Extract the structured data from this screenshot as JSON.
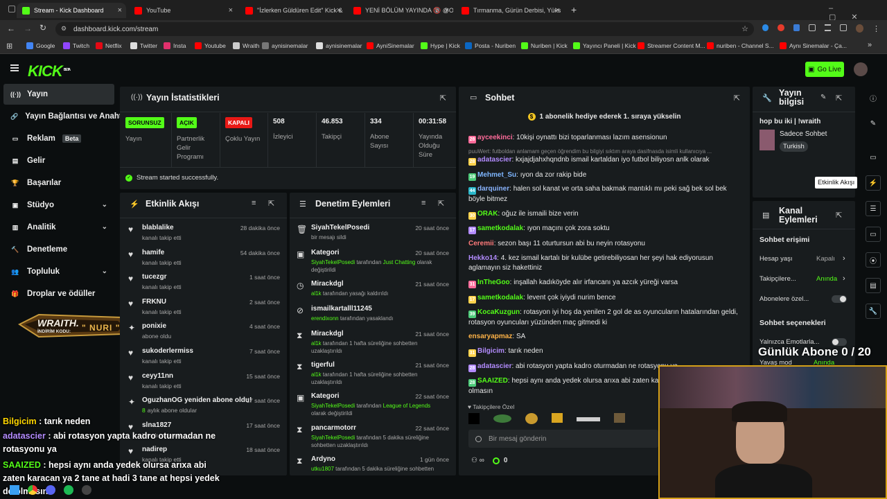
{
  "browser": {
    "tabs": [
      {
        "title": "Stream - Kick Dashboard",
        "color": "#53fc18"
      },
      {
        "title": "YouTube",
        "color": "#ff0000"
      },
      {
        "title": "\"İzlerken Güldüren Edit\" Kick &",
        "color": "#ff0000"
      },
      {
        "title": "YENİ BÖLÜM YAYINDA 🔞 @O",
        "color": "#ff0000"
      },
      {
        "title": "Tırmanma, Gürün Derbisi, Yüks",
        "color": "#ff0000"
      }
    ],
    "url": "dashboard.kick.com/stream",
    "bookmarks": [
      {
        "label": "Google",
        "color": "#4285f4"
      },
      {
        "label": "Twitch",
        "color": "#9146ff"
      },
      {
        "label": "Netflix",
        "color": "#e50914"
      },
      {
        "label": "Twitter",
        "color": "#dddddd"
      },
      {
        "label": "Insta",
        "color": "#e1306c"
      },
      {
        "label": "Youtube",
        "color": "#ff0000"
      },
      {
        "label": "Wraith",
        "color": "#cccccc"
      },
      {
        "label": "aynisinemalar",
        "color": "#777777"
      },
      {
        "label": "aynisinemalar",
        "color": "#dddddd"
      },
      {
        "label": "AyniSinemalar",
        "color": "#ff0000"
      },
      {
        "label": "Hype | Kick",
        "color": "#53fc18"
      },
      {
        "label": "Posta - Nuriben",
        "color": "#0a66c2"
      },
      {
        "label": "Nuriben | Kick",
        "color": "#53fc18"
      },
      {
        "label": "Yayıncı Paneli | Kick",
        "color": "#53fc18"
      },
      {
        "label": "Streamer Content M...",
        "color": "#ff0000"
      },
      {
        "label": "nuriben - Channel S...",
        "color": "#ff0000"
      },
      {
        "label": "Aynı Sinemalar - Ça...",
        "color": "#ff0000"
      }
    ]
  },
  "kick": {
    "logo": "KICK",
    "logo_sup": "BETA",
    "go_live": "Go Live"
  },
  "sidebar": [
    {
      "label": "Yayın",
      "icon": "radio-icon",
      "active": true
    },
    {
      "label": "Yayın Bağlantısı ve Anahtar",
      "icon": "link-icon"
    },
    {
      "label": "Reklam",
      "icon": "tv-icon",
      "badge": "Beta"
    },
    {
      "label": "Gelir",
      "icon": "wallet-icon"
    },
    {
      "label": "Başarılar",
      "icon": "trophy-icon"
    },
    {
      "label": "Stüdyo",
      "icon": "studio-icon",
      "chevron": true
    },
    {
      "label": "Analitik",
      "icon": "chart-icon",
      "chevron": true
    },
    {
      "label": "Denetleme",
      "icon": "hammer-icon"
    },
    {
      "label": "Topluluk",
      "icon": "users-icon",
      "chevron": true
    },
    {
      "label": "Droplar ve ödüller",
      "icon": "gift-icon"
    }
  ],
  "promo": {
    "brand": "WRAITH.",
    "code_label": "İNDİRİM KODU:",
    "code": "NURI"
  },
  "stats": {
    "title": "Yayın İstatistikleri",
    "badges": [
      {
        "text": "SORUNSUZ",
        "label": "Yayın",
        "bg": "#53fc18",
        "fg": "#0b0e0f"
      },
      {
        "text": "AÇIK",
        "label": "Partnerlik Gelir Programı",
        "bg": "#53fc18",
        "fg": "#0b0e0f"
      },
      {
        "text": "KAPALI",
        "label": "Çoklu Yayın",
        "bg": "#e91916",
        "fg": "#ffffff"
      }
    ],
    "values": [
      {
        "value": "508",
        "label": "İzleyici"
      },
      {
        "value": "46.853",
        "label": "Takipçi"
      },
      {
        "value": "334",
        "label": "Abone Sayısı"
      },
      {
        "value": "00:31:58",
        "label": "Yayında Olduğu Süre"
      }
    ],
    "success": "Stream started successfully."
  },
  "activity": {
    "title": "Etkinlik Akışı",
    "items": [
      {
        "name": "blablalike",
        "sub": "kanalı takip etti",
        "time": "28 dakika önce",
        "icon": "heart-icon"
      },
      {
        "name": "hamife",
        "sub": "kanalı takip etti",
        "time": "54 dakika önce",
        "icon": "heart-icon"
      },
      {
        "name": "tucezgr",
        "sub": "kanalı takip etti",
        "time": "1 saat önce",
        "icon": "heart-icon"
      },
      {
        "name": "FRKNU",
        "sub": "kanalı takip etti",
        "time": "2 saat önce",
        "icon": "heart-icon"
      },
      {
        "name": "ponixie",
        "sub": "abone oldu",
        "time": "4 saat önce",
        "icon": "star-icon"
      },
      {
        "name": "sukoderlermiss",
        "sub": "kanalı takip etti",
        "time": "7 saat önce",
        "icon": "heart-icon"
      },
      {
        "name": "ceyy11nn",
        "sub": "kanalı takip etti",
        "time": "15 saat önce",
        "icon": "heart-icon"
      },
      {
        "name": "OguzhanOG yeniden abone oldu!",
        "sub_g": "8",
        "sub": "aylık abone oldular",
        "time": "17 saat önce",
        "icon": "star-icon"
      },
      {
        "name": "slna1827",
        "sub": "kanalı takip etti",
        "time": "17 saat önce",
        "icon": "heart-icon"
      },
      {
        "name": "nadirep",
        "sub": "kanalı takip etti",
        "time": "18 saat önce",
        "icon": "heart-icon"
      }
    ]
  },
  "moderation": {
    "title": "Denetim Eylemleri",
    "items": [
      {
        "name": "SiyahTekelPosedi",
        "g": "",
        "sub": "bir mesajı sildi",
        "sub2": "",
        "time": "20 saat önce",
        "icon": "trash-icon"
      },
      {
        "name": "Kategori",
        "g": "SiyahTekelPosedi",
        "sub": " tarafından ",
        "g2": "Just Chatting",
        "sub2": " olarak",
        "sub3": "değiştirildi",
        "time": "20 saat önce",
        "icon": "category-icon"
      },
      {
        "name": "Mirackdgl",
        "g": "al1k",
        "sub": " tarafından yasağı kaldırıldı",
        "time": "21 saat önce",
        "icon": "clock-icon"
      },
      {
        "name": "ismailkartalll11245",
        "g": "erendixonn",
        "sub": " tarafından yasaklandı",
        "time": "",
        "icon": "ban-icon"
      },
      {
        "name": "Mirackdgl",
        "g": "al1k",
        "sub": " tarafından 1 hafta süreliğine sohbetten",
        "sub3": "uzaklaştırıldı",
        "time": "21 saat önce",
        "icon": "hourglass-icon"
      },
      {
        "name": "tigerful",
        "g": "al1k",
        "sub": " tarafından 1 hafta süreliğine sohbetten",
        "sub3": "uzaklaştırıldı",
        "time": "21 saat önce",
        "icon": "hourglass-icon"
      },
      {
        "name": "Kategori",
        "g": "SiyahTekelPosedi",
        "sub": " tarafından ",
        "g2": "League of Legends",
        "sub3": "olarak değiştirildi",
        "time": "22 saat önce",
        "icon": "category-icon"
      },
      {
        "name": "pancarmotorr",
        "g": "SiyahTekelPosedi",
        "sub": " tarafından 5 dakika süreliğine",
        "sub3": "sohbetten uzaklaştırıldı",
        "time": "22 saat önce",
        "icon": "hourglass-icon"
      },
      {
        "name": "Ardyno",
        "g": "utku1807",
        "sub": " tarafından 5 dakika süreliğine sohbetten",
        "time": "1 gün önce",
        "icon": "hourglass-icon"
      }
    ]
  },
  "chat": {
    "title": "Sohbet",
    "pinned": "1 abonelik hediye ederek 1. sıraya yükselin",
    "messages": [
      {
        "badge": "28",
        "user": "ayceekinci",
        "color": "#ff6b9a",
        "text": "10kişi oynattı bizi toparlanması lazım asensionun"
      },
      {
        "reply": "puuWert: futboldan anlamam geçen öğrendim bu bilgiyi sıktım araya dasifnasda isimli kullanıcıya ..."
      },
      {
        "badge": "28",
        "user": "adatascier",
        "color": "#b38cff",
        "text": "kxjajdjahxhqndnb ismail kartaldan iyo futbol biliyosn anlk olarak"
      },
      {
        "badge": "19",
        "user": "Mehmet_Su",
        "color": "#7eb6ff",
        "text": "ıyon da zor rakip bide"
      },
      {
        "badge": "44",
        "user": "darquiner",
        "color": "#8ab4ff",
        "text": "halen sol kanat ve orta saha bakmak mantıklı mı peki sağ bek sol bek böyle bitmez"
      },
      {
        "badge": "30",
        "user": "ORAK",
        "color": "#53fc18",
        "text": "oğuz ile ismaili bize verin"
      },
      {
        "badge": "17",
        "user": "sametkodalak",
        "color": "#53fc18",
        "text": "ıyon maçını çok zora soktu"
      },
      {
        "user": "Ceremii",
        "color": "#ff7a7a",
        "text": "sezon başı 11 oturtursun abi bu neyin rotasyonu"
      },
      {
        "user": "Hekko14",
        "color": "#b38cff",
        "text": "4. kez ismail kartalı bir kulübe getirebiliyosan her şeyi hak ediyorusun aglamayın siz hakettiniz"
      },
      {
        "badge": "31",
        "user": "InTheGoo",
        "color": "#53fc18",
        "text": "inşallah kadıköyde alır irfancanı ya azcık yüreği varsa"
      },
      {
        "badge": "17",
        "user": "sametkodalak",
        "color": "#53fc18",
        "text": "levent çok iyiydi nurim bence"
      },
      {
        "badge": "39",
        "user": "KocaKuzgun",
        "color": "#53fc18",
        "text": "rotasyon iyi hoş da yenilen 2 gol de as oyuncuların hatalarından geldi, rotasyon oyuncuları yüzünden maç gitmedi ki"
      },
      {
        "user": "ensaryapmaz",
        "color": "#ffb347",
        "text": "SA"
      },
      {
        "badge": "31",
        "user": "Bilgicim",
        "color": "#b38cff",
        "text": "tarık neden"
      },
      {
        "badge": "28",
        "user": "adatascier",
        "color": "#b38cff",
        "text": "abi rotasyon yapta kadro oturmadan ne rotasyonu ya"
      },
      {
        "badge": "28",
        "user": "SAAIZED",
        "color": "#53fc18",
        "text": "hepsi aynı anda yedek olursa arıxa abi zaten kar tane at hepsi yedek de olmasın"
      }
    ],
    "follower_only": "Takipçilere Özel",
    "input_placeholder": "Bir mesaj gönderin",
    "points": "0"
  },
  "stream_info": {
    "title": "Yayın bilgisi",
    "stream_title": "hop bu iki | !wraith",
    "category": "Sadece Sohbet",
    "language": "Turkish"
  },
  "channel_actions": {
    "title": "Kanal Eylemleri",
    "chat_access": "Sohbet erişimi",
    "rows": [
      {
        "label": "Hesap yaşı",
        "value": "Kapalı"
      },
      {
        "label": "Takipçilere...",
        "value": "Anında"
      },
      {
        "label": "Abonelere özel...",
        "value": ""
      }
    ],
    "chat_options": "Sohbet seçenekleri",
    "emote_only": "Yalnızca Emotlarla...",
    "slow_mode": "Yavaş mod",
    "slow_mode_value": "Anında"
  },
  "tooltip": "Etkinlik Akışı",
  "overlay": {
    "goal": "Günlük Abone 0 / 20",
    "chat": [
      {
        "user": "Bilgicim",
        "color": "#ffd700",
        "text": " : tarık neden"
      },
      {
        "user": "adatascier",
        "color": "#b38cff",
        "text": " : abi rotasyon yapta kadro oturmadan ne rotasyonu ya"
      },
      {
        "user": "SAAIZED",
        "color": "#53fc18",
        "text": " : hepsi aynı anda yedek olursa arıxa abi zaten karacan ya 2 tane at hadi 3 tane at hepsi yedek de olmasın"
      }
    ]
  }
}
